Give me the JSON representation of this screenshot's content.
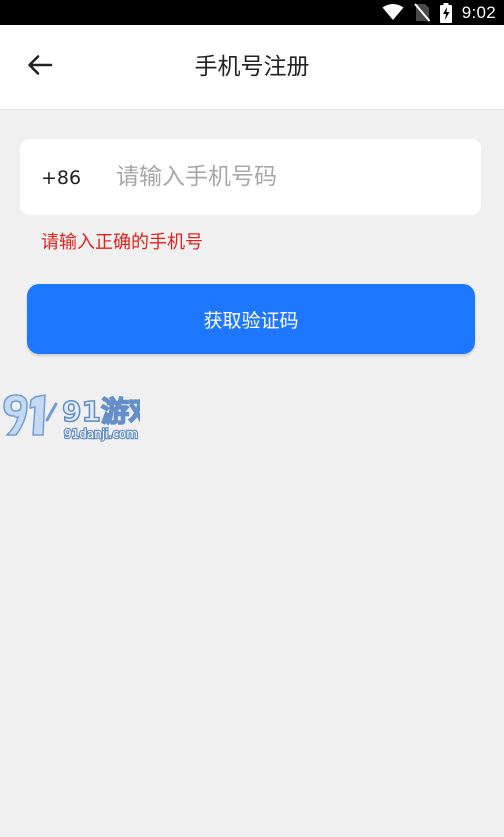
{
  "status_bar": {
    "time": "9:02",
    "icons": [
      "wifi-icon",
      "no-sim-icon",
      "battery-charging-icon"
    ]
  },
  "header": {
    "back_icon": "arrow-left-icon",
    "title": "手机号注册"
  },
  "phone_form": {
    "country_code": "+86",
    "phone_placeholder": "请输入手机号码",
    "phone_value": "",
    "error_message": "请输入正确的手机号",
    "submit_label": "获取验证码"
  },
  "watermark": {
    "logo_text": "91游戏",
    "domain": "91danji.com"
  },
  "colors": {
    "primary_button": "#1e78ff",
    "error": "#e0231e",
    "page_background": "#f0f0f0"
  }
}
